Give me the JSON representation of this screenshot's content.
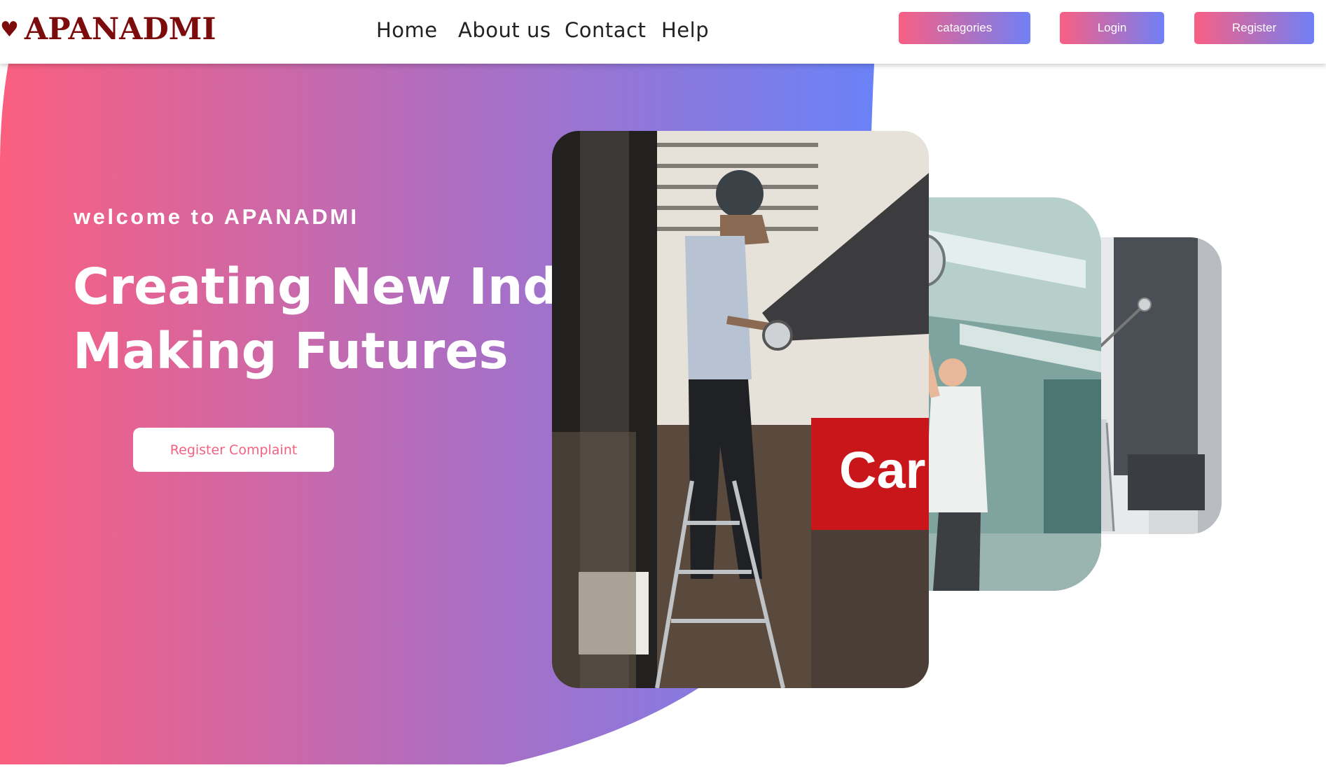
{
  "brand": {
    "name": "APANADMI",
    "icon": "heart-icon",
    "color": "#7c0b0b"
  },
  "nav": {
    "links": [
      {
        "label": "Home"
      },
      {
        "label": "About us"
      },
      {
        "label": "Contact"
      },
      {
        "label": "Help"
      }
    ]
  },
  "header_buttons": {
    "categories": "catagories",
    "login": "Login",
    "register": "Register"
  },
  "hero": {
    "welcome": "welcome to APANADMI",
    "headline_line1": "Creating New India",
    "headline_line2": "Making Futures",
    "cta_label": "Register Complaint"
  },
  "images": [
    {
      "subject": "worker-grinding-on-ladder-photo"
    },
    {
      "subject": "worker-sanding-ceiling-photo"
    },
    {
      "subject": "worker-painting-wall-photo"
    }
  ],
  "colors": {
    "gradient_start": "#fb5f7f",
    "gradient_end": "#6a82f7",
    "cta_text": "#f4607f",
    "nav_text": "#222222"
  }
}
